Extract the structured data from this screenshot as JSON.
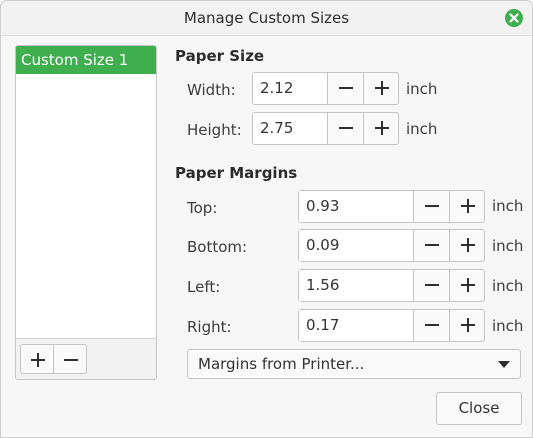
{
  "window": {
    "title": "Manage Custom Sizes"
  },
  "sizes_list": {
    "items": [
      "Custom Size 1"
    ],
    "selected_index": 0
  },
  "paper_size": {
    "heading": "Paper Size",
    "width": {
      "label": "Width:",
      "value": "2.12",
      "unit": "inch"
    },
    "height": {
      "label": "Height:",
      "value": "2.75",
      "unit": "inch"
    }
  },
  "paper_margins": {
    "heading": "Paper Margins",
    "top": {
      "label": "Top:",
      "value": "0.93",
      "unit": "inch"
    },
    "bottom": {
      "label": "Bottom:",
      "value": "0.09",
      "unit": "inch"
    },
    "left": {
      "label": "Left:",
      "value": "1.56",
      "unit": "inch"
    },
    "right": {
      "label": "Right:",
      "value": "0.17",
      "unit": "inch"
    }
  },
  "margins_dropdown": {
    "selected": "Margins from Printer..."
  },
  "buttons": {
    "close_label": "Close"
  },
  "icons": {
    "window_close": "close-icon",
    "add": "plus-icon",
    "remove": "minus-icon",
    "dropdown": "caret-down-icon"
  },
  "colors": {
    "accent": "#3fae4f"
  }
}
